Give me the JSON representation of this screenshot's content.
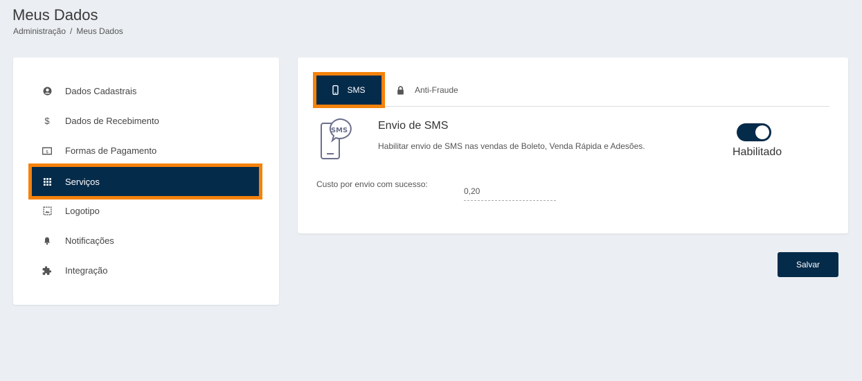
{
  "page": {
    "title": "Meus Dados",
    "breadcrumb": [
      "Administração",
      "/",
      "Meus Dados"
    ]
  },
  "sidebar": {
    "items": [
      {
        "label": "Dados Cadastrais",
        "icon": "account-circle-icon"
      },
      {
        "label": "Dados de Recebimento",
        "icon": "dollar-icon"
      },
      {
        "label": "Formas de Pagamento",
        "icon": "payment-icon"
      },
      {
        "label": "Serviços",
        "icon": "grid-icon",
        "active": true
      },
      {
        "label": "Logotipo",
        "icon": "image-icon"
      },
      {
        "label": "Notificações",
        "icon": "bell-icon"
      },
      {
        "label": "Integração",
        "icon": "puzzle-icon"
      }
    ]
  },
  "tabs": {
    "sms": "SMS",
    "antifraude": "Anti-Fraude"
  },
  "sms": {
    "title": "Envio de SMS",
    "description": "Habilitar envio de SMS nas vendas de Boleto, Venda Rápida e Adesões.",
    "toggle_label": "Habilitado",
    "enabled": true,
    "illustration_text": "SMS"
  },
  "cost": {
    "label": "Custo por envio com sucesso:",
    "value": "0,20"
  },
  "actions": {
    "save_label": "Salvar"
  },
  "colors": {
    "primary": "#052b4a",
    "highlight": "#f5820b",
    "background": "#ebeef2"
  }
}
